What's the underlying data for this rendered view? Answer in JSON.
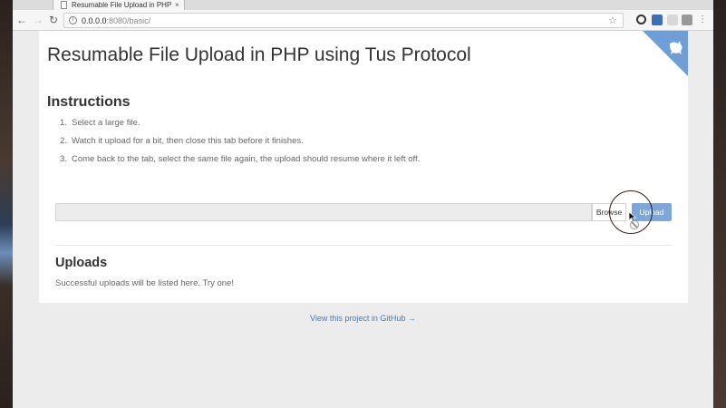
{
  "browser": {
    "tab_title": "Resumable File Upload in PHP",
    "tab_close": "×",
    "back_icon": "←",
    "forward_icon": "→",
    "reload_icon": "↻",
    "url_host": "0.0.0.0",
    "url_rest": ":8080/basic/",
    "star_icon": "☆",
    "menu_icon": "⋮"
  },
  "page": {
    "title": "Resumable File Upload in PHP using Tus Protocol",
    "instructions_heading": "Instructions",
    "instructions": [
      {
        "num": "1.",
        "text": "Select a large file."
      },
      {
        "num": "2.",
        "text": "Watch it upload for a bit, then close this tab before it finishes."
      },
      {
        "num": "3.",
        "text": "Come back to the tab, select the same file again, the upload should resume where it left off."
      }
    ],
    "browse_label": "Browse",
    "upload_label": "Upload",
    "uploads_heading": "Uploads",
    "uploads_empty": "Successful uploads will be listed here. Try one!",
    "github_link": "View this project in GitHub →"
  },
  "colors": {
    "accent": "#7ea7d9",
    "link": "#4a77b4"
  }
}
